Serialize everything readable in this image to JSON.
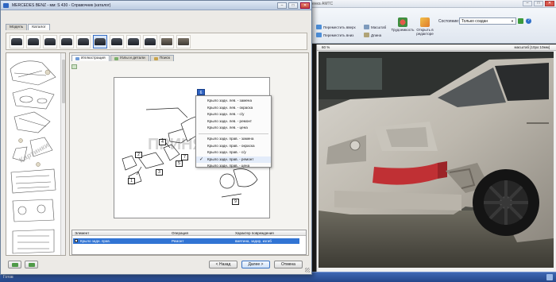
{
  "app": {
    "title": "MERCEDES BENZ S 430 (| - ПС:Комплекс 6 | Оценка АМТС",
    "ribbon": {
      "buttons": [
        {
          "label": "Переместить вверх",
          "icon": "arrow-up-icon"
        },
        {
          "label": "Переместить вниз",
          "icon": "arrow-down-icon"
        },
        {
          "label": "Масштаб",
          "icon": "zoom-icon"
        },
        {
          "label": "Длина",
          "icon": "ruler-icon"
        },
        {
          "label": "Трудоемкость",
          "icon": "labor-icon"
        },
        {
          "label": "Открыть в редакторе",
          "icon": "editor-icon"
        }
      ],
      "group_label": "Иллюстрация",
      "status_label": "Состояние:",
      "status_value": "Только создан"
    },
    "photo_pane": {
      "zoom": "60 %",
      "scale_info": "масштаб [10px:10мм]"
    },
    "taskbar_text": "Готов"
  },
  "dialog": {
    "title": "MERCEDES BENZ - мм: S 430 - Справочник (каталог)",
    "top_tabs": [
      "Модель",
      "Каталог"
    ],
    "active_top_tab": "Каталог",
    "thumbnails_count": 11,
    "inner_tabs": [
      "Иллюстрация",
      "Узлы и детали",
      "Поиск"
    ],
    "active_inner_tab": "Иллюстрация",
    "left_list_label": "Картинки",
    "watermark": "ПРИНЯТО",
    "callouts": [
      "1",
      "2",
      "3",
      "4",
      "5",
      "6",
      "7",
      "8",
      "9"
    ],
    "context_menu": {
      "badge": "6",
      "items": [
        {
          "label": "Крыло задн. лев. - замена",
          "checked": false
        },
        {
          "label": "Крыло задн. лев. - окраска",
          "checked": false
        },
        {
          "label": "Крыло задн. лев. - с/у",
          "checked": false
        },
        {
          "label": "Крыло задн. лев. - ремонт",
          "checked": false
        },
        {
          "label": "Крыло задн. лев. - цена",
          "checked": false
        },
        {
          "label": "Крыло задн. прав. - замена",
          "checked": false
        },
        {
          "label": "Крыло задн. прав. - окраска",
          "checked": false
        },
        {
          "label": "Крыло задн. прав. - с/у",
          "checked": false
        },
        {
          "label": "Крыло задн. прав. - ремонт",
          "checked": true
        },
        {
          "label": "Крыло задн. прав. - цена",
          "checked": false
        }
      ]
    },
    "table": {
      "columns": [
        "Элемент",
        "Операция",
        "Характер повреждения"
      ],
      "rows": [
        {
          "element": "Крыло задн. прав.",
          "operation": "Ремонт",
          "damage": "вмятина, задир, изгиб"
        }
      ]
    },
    "buttons": {
      "back": "< Назад",
      "next": "Далее >",
      "cancel": "Отмена"
    }
  }
}
